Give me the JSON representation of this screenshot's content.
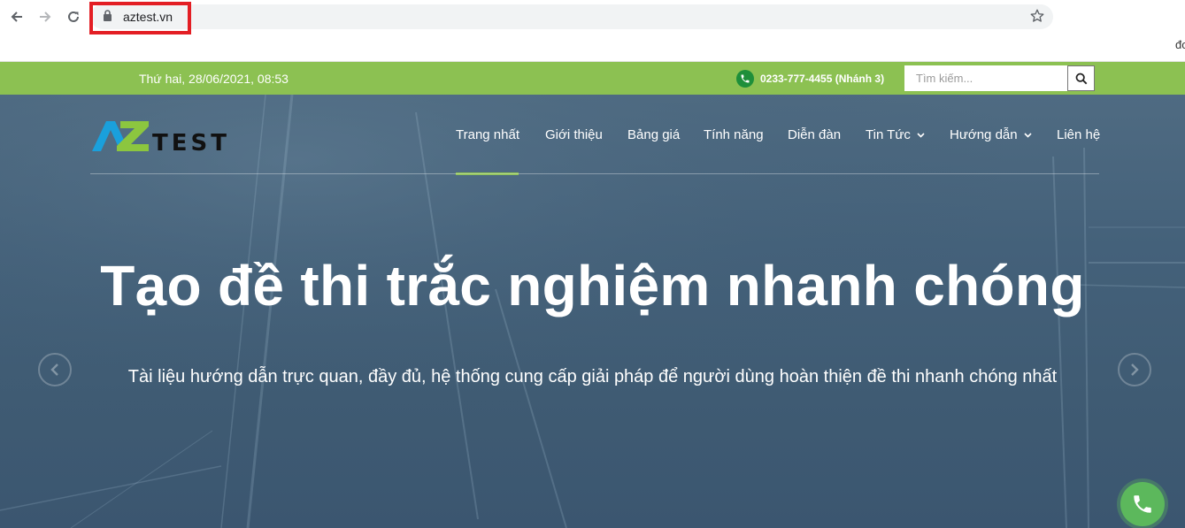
{
  "browser": {
    "url": "aztest.vn",
    "edge_text": "đơ"
  },
  "topbar": {
    "date": "Thứ hai, 28/06/2021, 08:53",
    "phone": "0233-777-4455 (Nhánh 3)",
    "search_placeholder": "Tìm kiếm..."
  },
  "logo": {
    "text_a": "A",
    "text_z": "Z",
    "text_test": "TEST"
  },
  "nav": {
    "items": [
      {
        "label": "Trang nhất",
        "active": true
      },
      {
        "label": "Giới thiệu"
      },
      {
        "label": "Bảng giá"
      },
      {
        "label": "Tính năng"
      },
      {
        "label": "Diễn đàn"
      },
      {
        "label": "Tin Tức",
        "dropdown": true
      },
      {
        "label": "Hướng dẫn",
        "dropdown": true
      },
      {
        "label": "Liên hệ"
      }
    ]
  },
  "hero": {
    "title": "Tạo đề thi trắc nghiệm nhanh chóng",
    "subtitle": "Tài liệu hướng dẫn trực quan, đầy đủ, hệ thống cung cấp giải pháp để người dùng hoàn thiện đề thi nhanh chóng nhất"
  },
  "colors": {
    "green_bar": "#8cc152",
    "hero_bg": "#44617a",
    "highlight_red": "#e31e24",
    "call_button": "#5cb85c"
  },
  "icons": {
    "back": "back-arrow-icon",
    "forward": "forward-arrow-icon",
    "reload": "reload-icon",
    "lock": "lock-icon",
    "bookmark": "star-icon",
    "phone": "phone-icon",
    "search": "search-icon",
    "prev": "chevron-left-icon",
    "next": "chevron-right-icon"
  }
}
